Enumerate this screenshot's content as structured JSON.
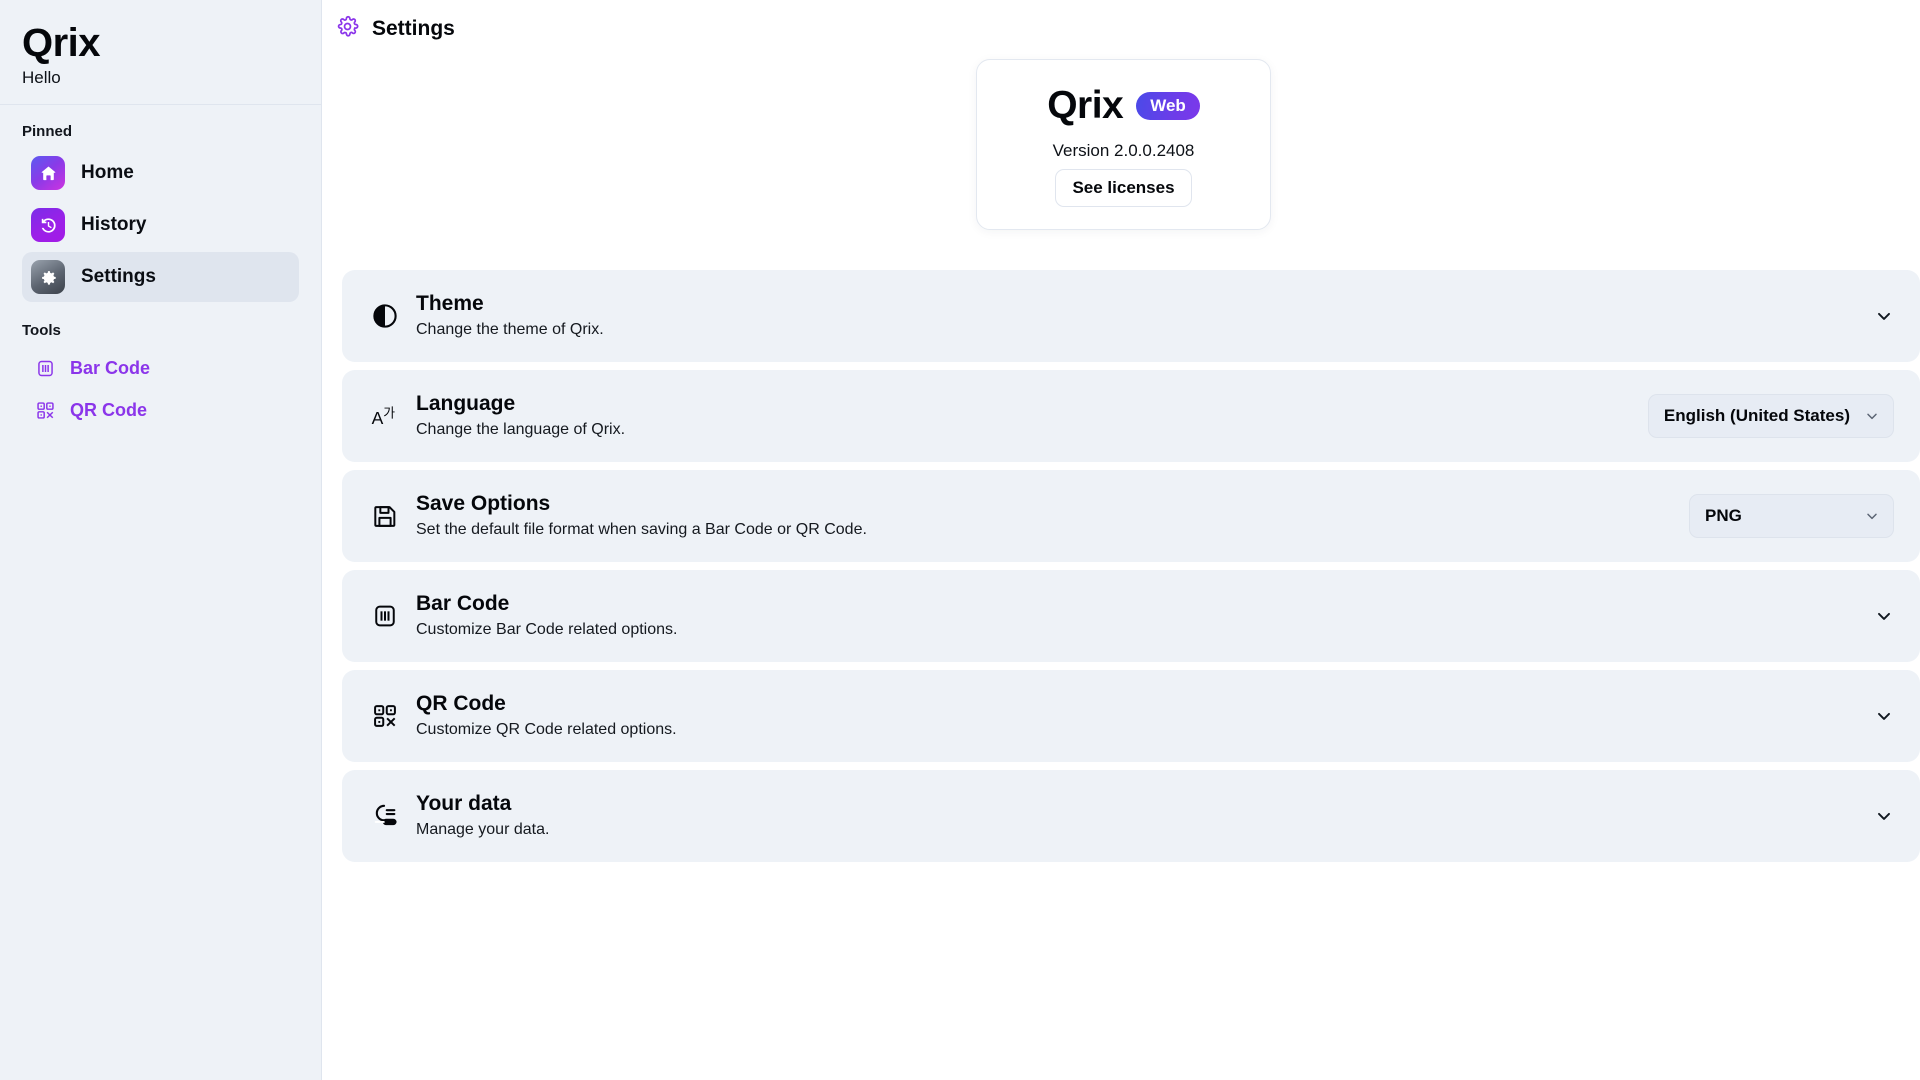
{
  "sidebar": {
    "brand": "Qrix",
    "greeting": "Hello",
    "pinned_label": "Pinned",
    "tools_label": "Tools",
    "pinned": [
      {
        "label": "Home",
        "icon": "home-icon",
        "active": false
      },
      {
        "label": "History",
        "icon": "history-icon",
        "active": false
      },
      {
        "label": "Settings",
        "icon": "gear-icon",
        "active": true
      }
    ],
    "tools": [
      {
        "label": "Bar Code",
        "icon": "barcode-icon"
      },
      {
        "label": "QR Code",
        "icon": "qrcode-icon"
      }
    ]
  },
  "header": {
    "title": "Settings",
    "icon": "gear-icon"
  },
  "version_card": {
    "logo": "Qrix",
    "badge": "Web",
    "version": "Version 2.0.0.2408",
    "licenses_button": "See licenses"
  },
  "settings_rows": [
    {
      "title": "Theme",
      "subtitle": "Change the theme of Qrix.",
      "icon": "contrast-icon",
      "control": "chevron",
      "chevron": "chevron-down-icon"
    },
    {
      "title": "Language",
      "subtitle": "Change the language of Qrix.",
      "icon": "translate-icon",
      "control": "dropdown",
      "value": "English (United States)"
    },
    {
      "title": "Save Options",
      "subtitle": "Set the default file format when saving a Bar Code or QR Code.",
      "icon": "save-icon",
      "control": "dropdown",
      "value": "PNG"
    },
    {
      "title": "Bar Code",
      "subtitle": "Customize Bar Code related options.",
      "icon": "barcode-icon",
      "control": "chevron",
      "chevron": "chevron-down-icon"
    },
    {
      "title": "QR Code",
      "subtitle": "Customize QR Code related options.",
      "icon": "qrcode-icon",
      "control": "chevron",
      "chevron": "chevron-down-icon"
    },
    {
      "title": "Your data",
      "subtitle": "Manage your data.",
      "icon": "data-usage-icon",
      "control": "chevron",
      "chevron": "chevron-down-icon"
    }
  ],
  "colors": {
    "accent_purple": "#8b35ea",
    "sidebar_bg": "#eef2f7",
    "card_bg": "#eef2f7",
    "page_bg": "#ffffff",
    "badge_gradient_start": "#4a4ae8",
    "badge_gradient_end": "#7c38ea"
  }
}
